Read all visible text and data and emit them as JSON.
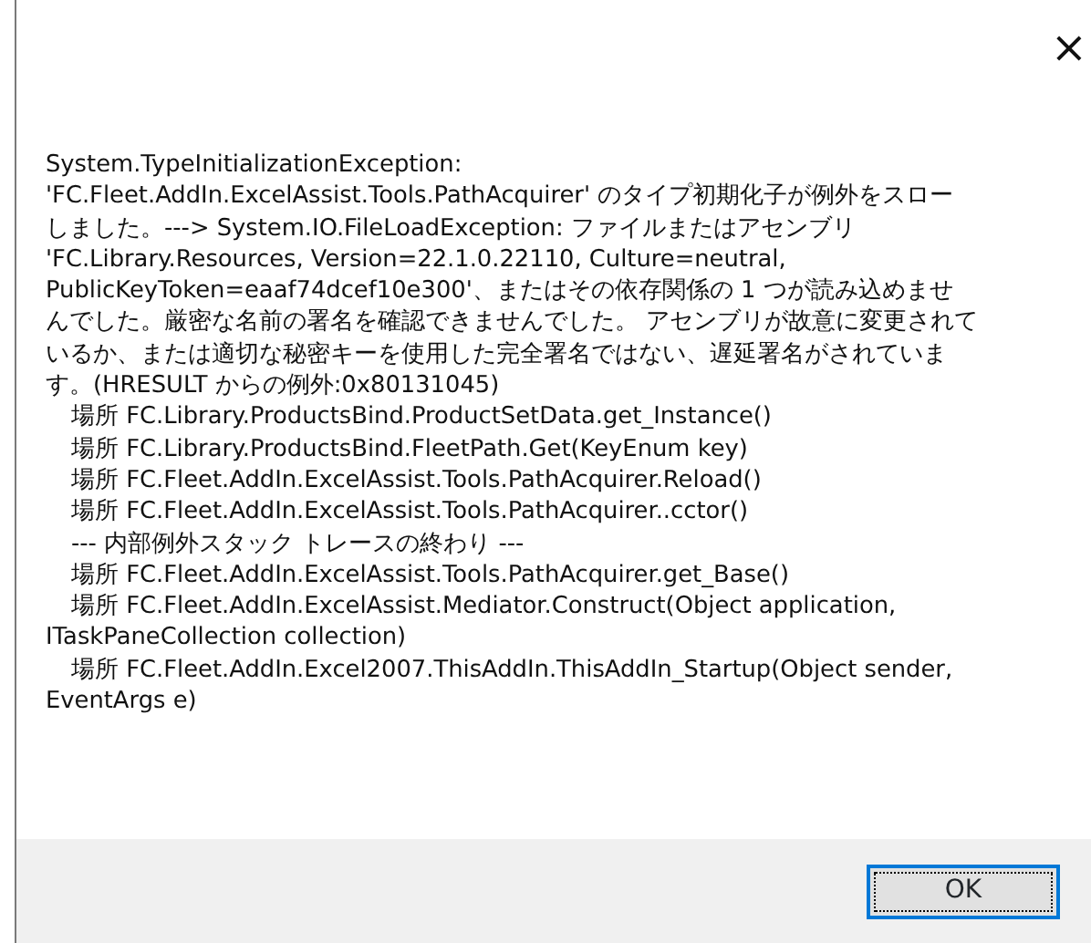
{
  "window": {
    "close_button": "×"
  },
  "message": [
    {
      "text": "System.TypeInitializationException:",
      "indent": false
    },
    {
      "text": "'FC.Fleet.AddIn.ExcelAssist.Tools.PathAcquirer' のタイプ初期化子が例外をスロー",
      "indent": false
    },
    {
      "text": "しました。---> System.IO.FileLoadException: ファイルまたはアセンブリ",
      "indent": false
    },
    {
      "text": "'FC.Library.Resources, Version=22.1.0.22110, Culture=neutral,",
      "indent": false
    },
    {
      "text": "PublicKeyToken=eaaf74dcef10e300'、またはその依存関係の 1 つが読み込めませ",
      "indent": false
    },
    {
      "text": "んでした。厳密な名前の署名を確認できませんでした。 アセンブリが故意に変更されて",
      "indent": false
    },
    {
      "text": "いるか、または適切な秘密キーを使用した完全署名ではない、遅延署名がされていま",
      "indent": false
    },
    {
      "text": "す。(HRESULT からの例外:0x80131045)",
      "indent": false
    },
    {
      "text": "場所 FC.Library.ProductsBind.ProductSetData.get_Instance()",
      "indent": true
    },
    {
      "text": "場所 FC.Library.ProductsBind.FleetPath.Get(KeyEnum key)",
      "indent": true
    },
    {
      "text": "場所 FC.Fleet.AddIn.ExcelAssist.Tools.PathAcquirer.Reload()",
      "indent": true
    },
    {
      "text": "場所 FC.Fleet.AddIn.ExcelAssist.Tools.PathAcquirer..cctor()",
      "indent": true
    },
    {
      "text": "--- 内部例外スタック トレースの終わり ---",
      "indent": true
    },
    {
      "text": "場所 FC.Fleet.AddIn.ExcelAssist.Tools.PathAcquirer.get_Base()",
      "indent": true
    },
    {
      "text": "場所 FC.Fleet.AddIn.ExcelAssist.Mediator.Construct(Object application,",
      "indent": true
    },
    {
      "text": "ITaskPaneCollection collection)",
      "indent": false
    },
    {
      "text": "場所 FC.Fleet.AddIn.Excel2007.ThisAddIn.ThisAddIn_Startup(Object sender,",
      "indent": true
    },
    {
      "text": "EventArgs e)",
      "indent": false
    }
  ],
  "buttons": [
    {
      "label": "OK",
      "selected": true
    }
  ]
}
